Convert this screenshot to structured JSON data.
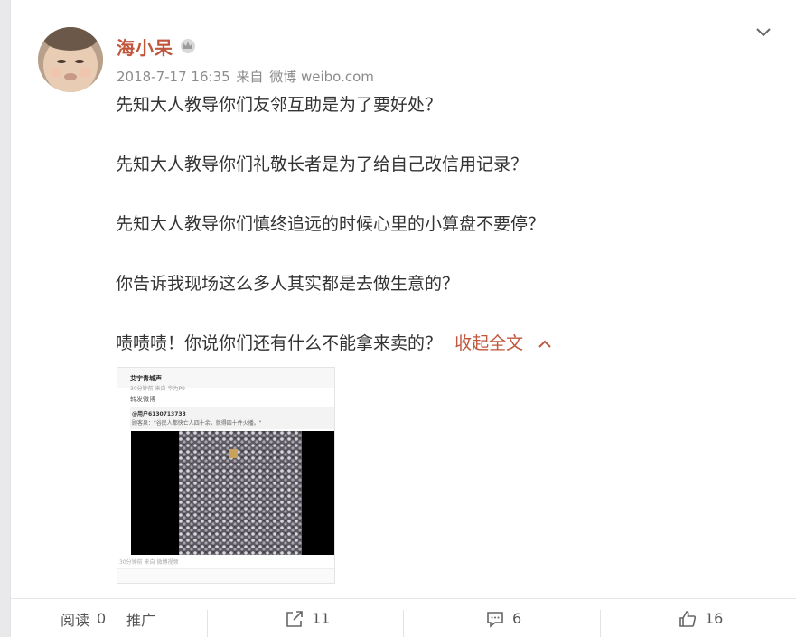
{
  "post": {
    "username": "海小呆",
    "date": "2018-7-17 16:35",
    "source_prefix": "来自",
    "source": "微博 weibo.com",
    "paragraphs": [
      "先知大人教导你们友邻互助是为了要好处？",
      "先知大人教导你们礼敬长者是为了给自己改信用记录？",
      "先知大人教导你们慎终追远的时候心里的小算盘不要停？",
      "你告诉我现场这么多人其实都是去做生意的？",
      "啧啧啧！你说你们还有什么不能拿来卖的？"
    ],
    "collapse_label": "收起全文"
  },
  "thumbnail": {
    "header_name": "艾宇青城声",
    "header_meta": "30分钟前 来自 华为P9",
    "forward_label": "转发微博",
    "quoted_user": "@用户6130713733",
    "quoted_text": "顾客泉：\"谷民人都快亡人四十余，就得四十件火播。\"",
    "footer_meta": "30分钟前 来自 微博视频"
  },
  "footer": {
    "read_label": "阅读",
    "read_count": "0",
    "promote_label": "推广",
    "repost_count": "11",
    "comment_count": "6",
    "like_count": "16"
  },
  "icons": {
    "badge": "crown-icon",
    "menu": "chevron-down-icon",
    "repost": "share-icon",
    "comment": "comment-icon",
    "like": "thumbs-up-icon"
  },
  "colors": {
    "username": "#c0573d",
    "link": "#c0573d",
    "meta": "#8c8c8c"
  }
}
